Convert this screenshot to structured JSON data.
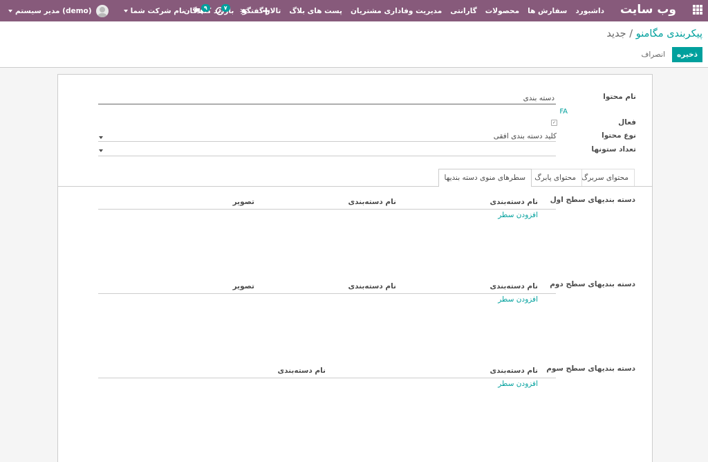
{
  "navbar": {
    "brand": "وب سایت",
    "menu": [
      "داشبورد",
      "سفارش ها",
      "محصولات",
      "گارانتی",
      "مدیریت وفاداری مشتریان",
      "پست های بلاگ",
      "تالار گفتگو",
      "بازدید کنندگان"
    ],
    "activity_count": "۷",
    "messages_count": "۹",
    "company": "نام شرکت شما",
    "user": "مدیر سیستم (demo)"
  },
  "breadcrumb": {
    "parent": "پیکربندی مگامنو",
    "separator": " / ",
    "current": "جدید"
  },
  "buttons": {
    "save": "ذخیره",
    "discard": "انصراف"
  },
  "form": {
    "name_label": "نام محتوا",
    "name_value": "دسته بندی",
    "lang": "FA",
    "active_label": "فعال",
    "type_label": "نوع محتوا",
    "type_value": "کلید دسته بندی افقی",
    "columns_label": "تعداد ستونها",
    "columns_value": ""
  },
  "tabs": [
    "محتوای سربرگ",
    "محتوای پابرگ",
    "سطرهای منوی دسته بندیها"
  ],
  "sections": [
    {
      "label": "دسته بندیهای سطح اول",
      "headers": [
        "نام دسته‌بندی",
        "نام دسته‌بندی",
        "تصویر"
      ],
      "add": "افزودن سطر"
    },
    {
      "label": "دسته بندیهای سطح دوم",
      "headers": [
        "نام دسته‌بندی",
        "نام دسته‌بندی",
        "تصویر"
      ],
      "add": "افزودن سطر"
    },
    {
      "label": "دسته بندیهای سطح سوم",
      "headers": [
        "نام دسته‌بندی",
        "نام دسته‌بندی"
      ],
      "add": "افزودن سطر"
    }
  ],
  "colors": {
    "navbar": "#875a7b",
    "accent": "#00a09d"
  }
}
